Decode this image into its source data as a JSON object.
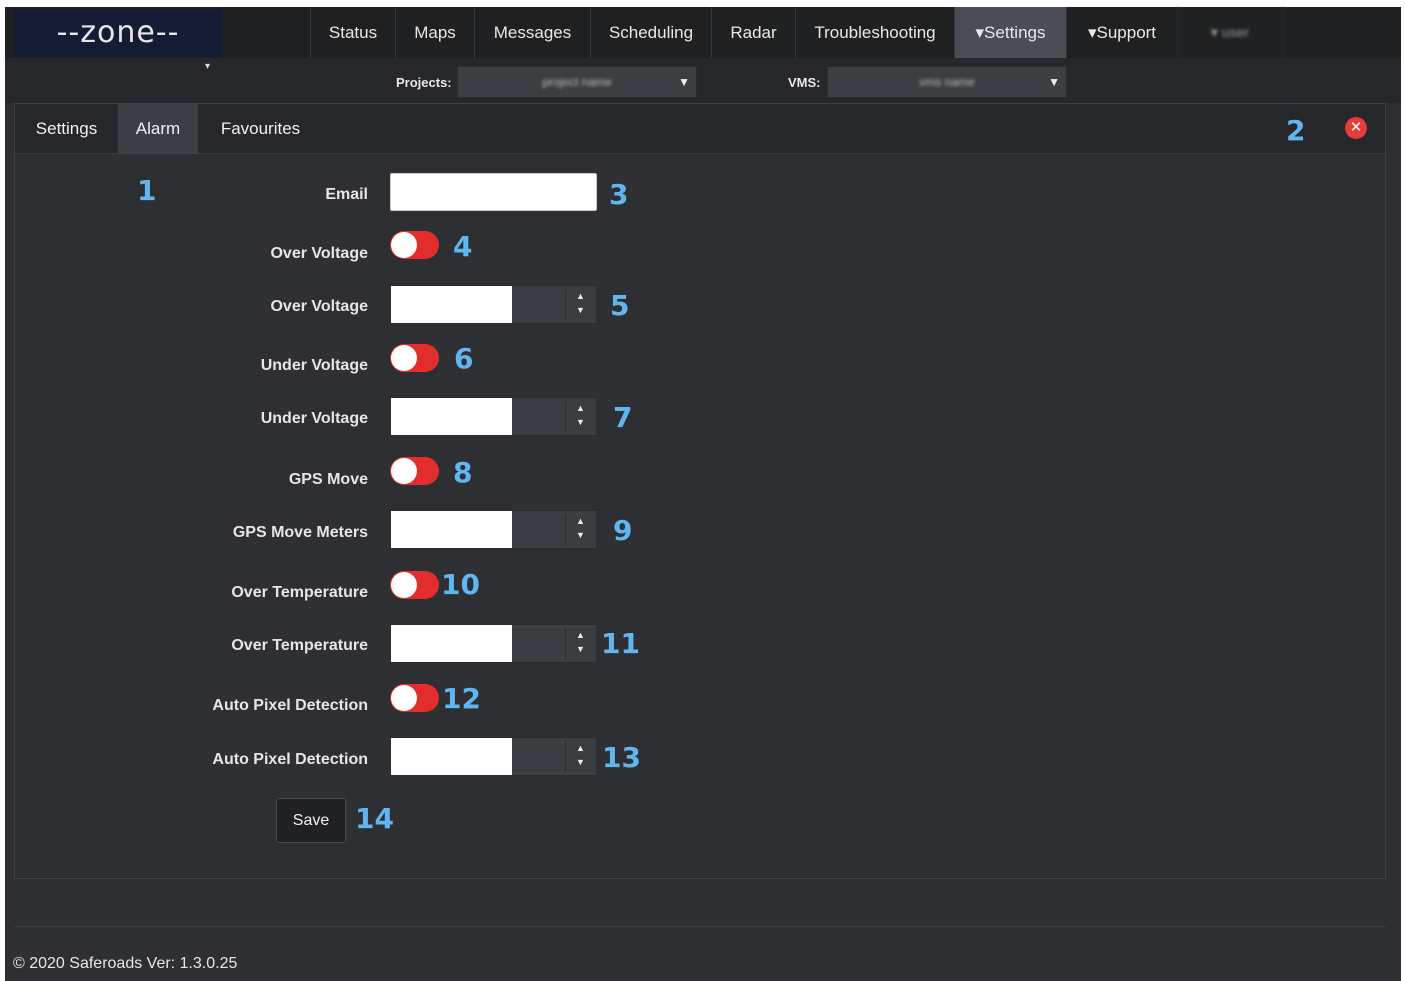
{
  "logo": {
    "text": "--zone--"
  },
  "nav": {
    "items": [
      {
        "label": "Status"
      },
      {
        "label": "Maps"
      },
      {
        "label": "Messages"
      },
      {
        "label": "Scheduling"
      },
      {
        "label": "Radar"
      },
      {
        "label": "Troubleshooting"
      },
      {
        "label": "▾Settings",
        "active": true
      },
      {
        "label": "▾Support"
      },
      {
        "label": "▾ user"
      }
    ]
  },
  "subbar": {
    "projects_label": "Projects:",
    "projects_value": "project name",
    "vms_label": "VMS:",
    "vms_value": "vms name",
    "caret": "▾"
  },
  "tabs": [
    {
      "label": "Settings"
    },
    {
      "label": "Alarm",
      "active": true
    },
    {
      "label": "Favourites"
    }
  ],
  "close_icon": "✕",
  "form": {
    "email_label": "Email",
    "over_voltage_toggle_label": "Over Voltage",
    "over_voltage_value_label": "Over Voltage",
    "under_voltage_toggle_label": "Under Voltage",
    "under_voltage_value_label": "Under Voltage",
    "gps_move_toggle_label": "GPS Move",
    "gps_move_meters_label": "GPS Move Meters",
    "over_temperature_toggle_label": "Over Temperature",
    "over_temperature_value_label": "Over Temperature",
    "auto_pixel_toggle_label": "Auto Pixel Detection",
    "auto_pixel_value_label": "Auto Pixel Detection",
    "save_label": "Save"
  },
  "annotations": [
    "1",
    "2",
    "3",
    "4",
    "5",
    "6",
    "7",
    "8",
    "9",
    "10",
    "11",
    "12",
    "13",
    "14"
  ],
  "footer": {
    "text": "© 2020 Saferoads Ver: 1.3.0.25"
  },
  "colors": {
    "toggle_off": "#e32d2d",
    "annotation": "#62b6f0",
    "background": "#2d2f33"
  }
}
